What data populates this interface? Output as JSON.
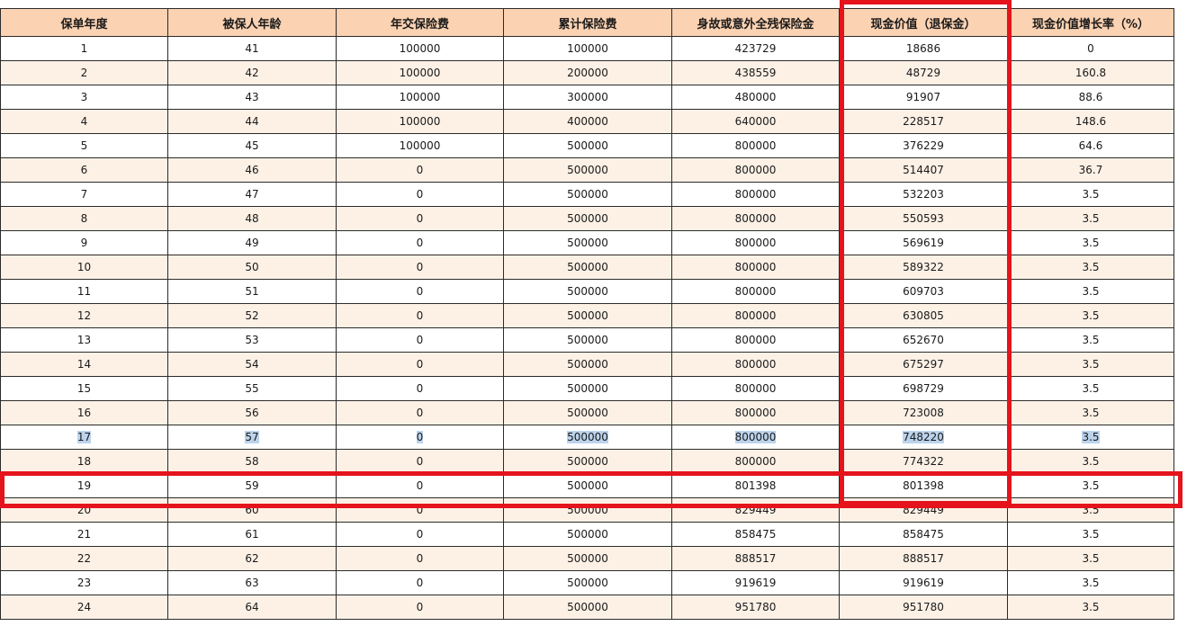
{
  "table": {
    "headers": [
      "保单年度",
      "被保人年龄",
      "年交保险费",
      "累计保险费",
      "身故或意外全残保险金",
      "现金价值（退保金）",
      "现金价值增长率（%）"
    ],
    "rows": [
      [
        "1",
        "41",
        "100000",
        "100000",
        "423729",
        "18686",
        "0"
      ],
      [
        "2",
        "42",
        "100000",
        "200000",
        "438559",
        "48729",
        "160.8"
      ],
      [
        "3",
        "43",
        "100000",
        "300000",
        "480000",
        "91907",
        "88.6"
      ],
      [
        "4",
        "44",
        "100000",
        "400000",
        "640000",
        "228517",
        "148.6"
      ],
      [
        "5",
        "45",
        "100000",
        "500000",
        "800000",
        "376229",
        "64.6"
      ],
      [
        "6",
        "46",
        "0",
        "500000",
        "800000",
        "514407",
        "36.7"
      ],
      [
        "7",
        "47",
        "0",
        "500000",
        "800000",
        "532203",
        "3.5"
      ],
      [
        "8",
        "48",
        "0",
        "500000",
        "800000",
        "550593",
        "3.5"
      ],
      [
        "9",
        "49",
        "0",
        "500000",
        "800000",
        "569619",
        "3.5"
      ],
      [
        "10",
        "50",
        "0",
        "500000",
        "800000",
        "589322",
        "3.5"
      ],
      [
        "11",
        "51",
        "0",
        "500000",
        "800000",
        "609703",
        "3.5"
      ],
      [
        "12",
        "52",
        "0",
        "500000",
        "800000",
        "630805",
        "3.5"
      ],
      [
        "13",
        "53",
        "0",
        "500000",
        "800000",
        "652670",
        "3.5"
      ],
      [
        "14",
        "54",
        "0",
        "500000",
        "800000",
        "675297",
        "3.5"
      ],
      [
        "15",
        "55",
        "0",
        "500000",
        "800000",
        "698729",
        "3.5"
      ],
      [
        "16",
        "56",
        "0",
        "500000",
        "800000",
        "723008",
        "3.5"
      ],
      [
        "17",
        "57",
        "0",
        "500000",
        "800000",
        "748220",
        "3.5"
      ],
      [
        "18",
        "58",
        "0",
        "500000",
        "800000",
        "774322",
        "3.5"
      ],
      [
        "19",
        "59",
        "0",
        "500000",
        "801398",
        "801398",
        "3.5"
      ],
      [
        "20",
        "60",
        "0",
        "500000",
        "829449",
        "829449",
        "3.5"
      ],
      [
        "21",
        "61",
        "0",
        "500000",
        "858475",
        "858475",
        "3.5"
      ],
      [
        "22",
        "62",
        "0",
        "500000",
        "888517",
        "888517",
        "3.5"
      ],
      [
        "23",
        "63",
        "0",
        "500000",
        "919619",
        "919619",
        "3.5"
      ],
      [
        "24",
        "64",
        "0",
        "500000",
        "951780",
        "951780",
        "3.5"
      ]
    ],
    "selected_row": "17",
    "highlighted_row": "19",
    "highlighted_column": "现金价值（退保金）"
  },
  "colors": {
    "header_bg": "#fbd2b2",
    "stripe_bg": "#fdf1e6",
    "selection_bg": "#bcd3ec",
    "highlight_border": "#e5131b"
  }
}
